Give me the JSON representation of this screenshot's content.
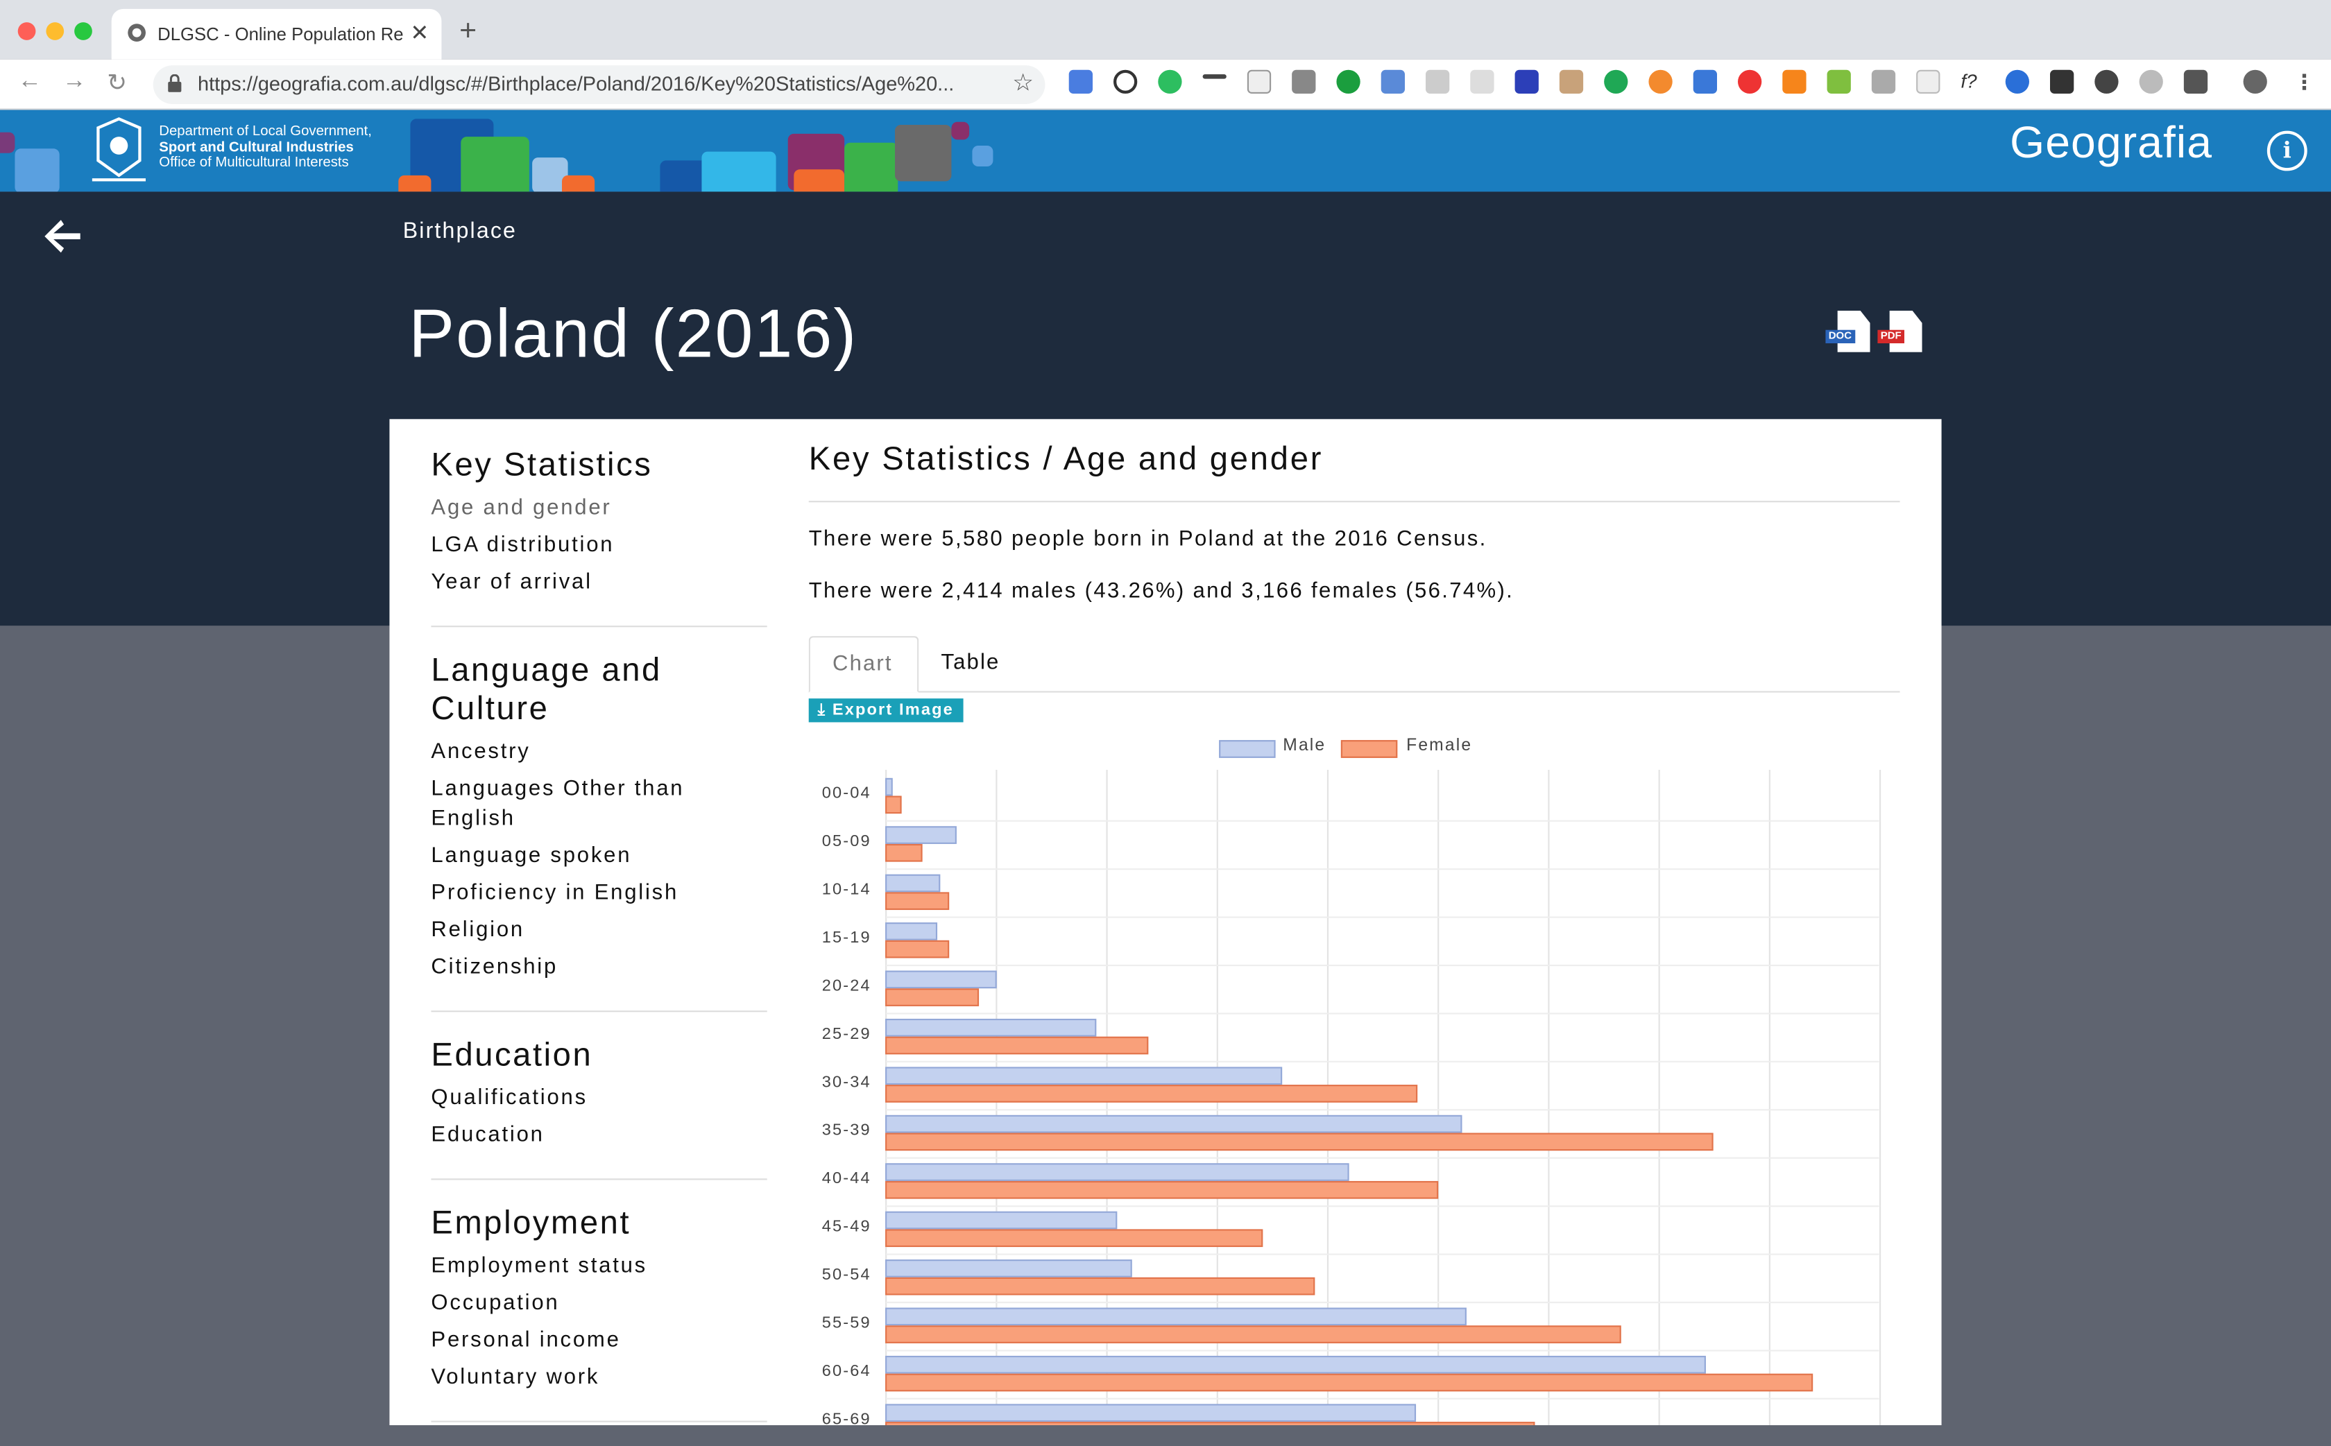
{
  "browser": {
    "tab_title": "DLGSC - Online Population Re",
    "url": "https://geografia.com.au/dlgsc/#/Birthplace/Poland/2016/Key%20Statistics/Age%20..."
  },
  "banner": {
    "dept_line1": "Department of Local Government,",
    "dept_line2": "Sport and Cultural Industries",
    "dept_line3": "Office of Multicultural Interests",
    "brand": "Geografia",
    "info_glyph": "i"
  },
  "header": {
    "breadcrumb": "Birthplace",
    "title": "Poland (2016)",
    "doc_label": "DOC",
    "pdf_label": "PDF"
  },
  "sidebar": {
    "sections": [
      {
        "heading": "Key Statistics",
        "items": [
          "Age and gender",
          "LGA distribution",
          "Year of arrival"
        ]
      },
      {
        "heading": "Language and Culture",
        "items": [
          "Ancestry",
          "Languages Other than English",
          "Language spoken",
          "Proficiency in English",
          "Religion",
          "Citizenship"
        ]
      },
      {
        "heading": "Education",
        "items": [
          "Qualifications",
          "Education"
        ]
      },
      {
        "heading": "Employment",
        "items": [
          "Employment status",
          "Occupation",
          "Personal income",
          "Voluntary work"
        ]
      }
    ]
  },
  "main": {
    "heading": "Key Statistics / Age and gender",
    "para1": "There were 5,580 people born in Poland at the 2016 Census.",
    "para2": "There were 2,414 males (43.26%) and 3,166 females (56.74%).",
    "tab_chart": "Chart",
    "tab_table": "Table",
    "export_label": "Export Image"
  },
  "colors": {
    "male": "#c3d1ef",
    "male_border": "#93a8d8",
    "female": "#f9a07a",
    "female_border": "#e2734a",
    "banner": "#1a7dbf",
    "header": "#1e2b3d"
  },
  "chart_data": {
    "type": "bar",
    "orientation": "horizontal",
    "categories": [
      "00-04",
      "05-09",
      "10-14",
      "15-19",
      "20-24",
      "25-29",
      "30-34",
      "35-39",
      "40-44",
      "45-49",
      "50-54",
      "55-59",
      "60-64",
      "65-69"
    ],
    "series": [
      {
        "name": "Male",
        "values": [
          4,
          47,
          36,
          34,
          74,
          141,
          266,
          387,
          311,
          155,
          165,
          390,
          551,
          356
        ]
      },
      {
        "name": "Female",
        "values": [
          10,
          24,
          42,
          42,
          62,
          176,
          357,
          556,
          371,
          253,
          288,
          494,
          623,
          436
        ]
      }
    ],
    "legend": "top-center",
    "grid": true
  }
}
